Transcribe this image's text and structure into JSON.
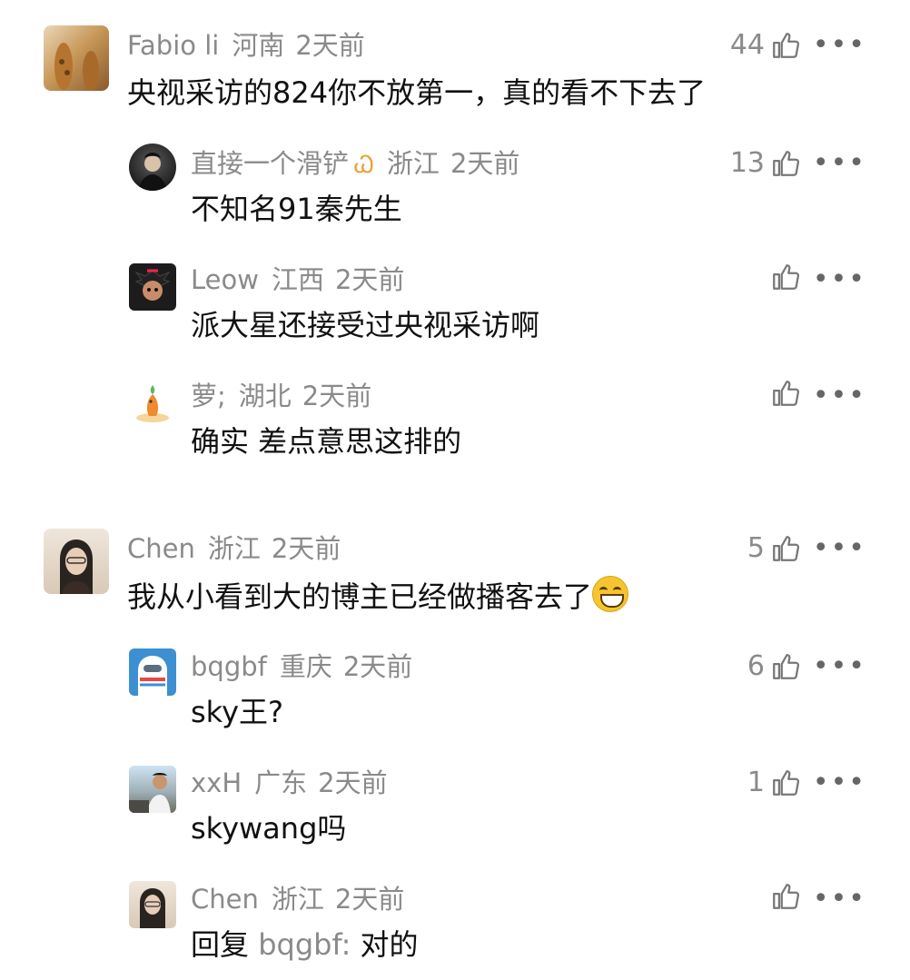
{
  "comments": [
    {
      "user": "Fabio li",
      "location": "河南",
      "time": "2天前",
      "likes": "44",
      "text": "央视采访的824你不放第一，真的看不下去了",
      "replies": [
        {
          "user": "直接一个滑铲",
          "badge": "butterfly",
          "location": "浙江",
          "time": "2天前",
          "likes": "13",
          "text": "不知名91秦先生"
        },
        {
          "user": "Leow",
          "location": "江西",
          "time": "2天前",
          "likes": "",
          "text": "派大星还接受过央视采访啊"
        },
        {
          "user": "萝;",
          "location": "湖北",
          "time": "2天前",
          "likes": "",
          "text": "确实 差点意思这排的"
        }
      ]
    },
    {
      "user": "Chen",
      "location": "浙江",
      "time": "2天前",
      "likes": "5",
      "text": "我从小看到大的博主已经做播客去了",
      "replies": [
        {
          "user": "bqgbf",
          "location": "重庆",
          "time": "2天前",
          "likes": "6",
          "text": "sky王?"
        },
        {
          "user": "xxH",
          "location": "广东",
          "time": "2天前",
          "likes": "1",
          "text": "skywang吗"
        },
        {
          "user": "Chen",
          "location": "浙江",
          "time": "2天前",
          "likes": "",
          "text_prefix": "回复 ",
          "text_mention": "bqgbf:",
          "text_suffix": " 对的"
        }
      ]
    }
  ],
  "icons": {
    "like": "thumbs-up-icon",
    "more": "more-dots-icon",
    "emoji": "grinning-emoji-icon"
  },
  "more_label": "•••"
}
